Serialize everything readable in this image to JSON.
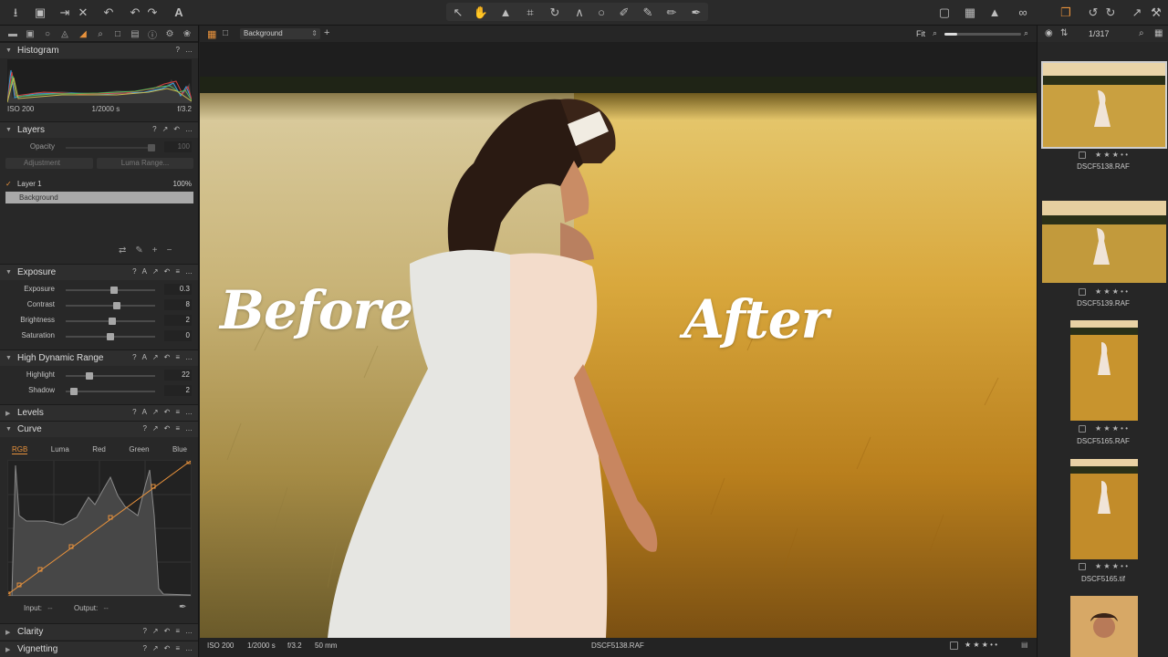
{
  "toolbar": {
    "left_icons": [
      "import-icon",
      "camera-icon",
      "export-icon",
      "close-icon",
      "undo-icon",
      "undo-back-icon",
      "redo-icon",
      "text-tool-icon"
    ],
    "center_icons": [
      "select-icon",
      "hand-icon",
      "brush-icon",
      "crop-icon",
      "rotate-icon",
      "keystone-icon",
      "circle-icon",
      "picker-icon",
      "draw-icon",
      "eraser-icon",
      "gradient-icon"
    ],
    "right_icons": [
      "edit-icon",
      "grid-icon",
      "warning-icon",
      "glasses-icon",
      "stack-icon",
      "rotate-left-icon",
      "rotate-right-icon",
      "arrow-icon",
      "tools-icon"
    ],
    "accent": "#e8923c"
  },
  "histogram": {
    "title": "Histogram",
    "iso": "ISO 200",
    "shutter": "1/2000 s",
    "aperture": "f/3.2"
  },
  "layers": {
    "title": "Layers",
    "opacity_label": "Opacity",
    "opacity_value": "100",
    "adjustment_label": "Adjustment",
    "luma_label": "Luma Range...",
    "layer1_name": "Layer 1",
    "layer1_opacity": "100%",
    "background_name": "Background"
  },
  "exposure": {
    "title": "Exposure",
    "sliders": [
      {
        "label": "Exposure",
        "value": "0.3",
        "level": 0.54
      },
      {
        "label": "Contrast",
        "value": "8",
        "level": 0.58
      },
      {
        "label": "Brightness",
        "value": "2",
        "level": 0.52
      },
      {
        "label": "Saturation",
        "value": "0",
        "level": 0.5
      }
    ]
  },
  "hdr": {
    "title": "High Dynamic Range",
    "sliders": [
      {
        "label": "Highlight",
        "value": "22",
        "level": 0.24
      },
      {
        "label": "Shadow",
        "value": "2",
        "level": 0.06
      }
    ]
  },
  "levels": {
    "title": "Levels"
  },
  "curve": {
    "title": "Curve",
    "tabs": [
      "RGB",
      "Luma",
      "Red",
      "Green",
      "Blue"
    ],
    "active_tab": "RGB",
    "input_label": "Input:",
    "input_value": "--",
    "output_label": "Output:",
    "output_value": "--"
  },
  "clarity": {
    "title": "Clarity"
  },
  "vignetting": {
    "title": "Vignetting"
  },
  "viewer": {
    "variant": "Background",
    "zoom_label": "Fit",
    "before_label": "Before",
    "after_label": "After",
    "iso": "ISO 200",
    "shutter": "1/2000 s",
    "aperture": "f/3.2",
    "focal": "50 mm",
    "filename": "DSCF5138.RAF",
    "rating_dots": "★ ★ ★ • •"
  },
  "browser": {
    "counter": "1/317",
    "thumbs": [
      {
        "name": "DSCF5138.RAF",
        "stars": "★ ★ ★ • •"
      },
      {
        "name": "DSCF5139.RAF",
        "stars": "★ ★ ★ • •"
      },
      {
        "name": "DSCF5165.RAF",
        "stars": "★ ★ ★ • •"
      },
      {
        "name": "DSCF5165.tif",
        "stars": "★ ★ ★ • •"
      }
    ]
  }
}
